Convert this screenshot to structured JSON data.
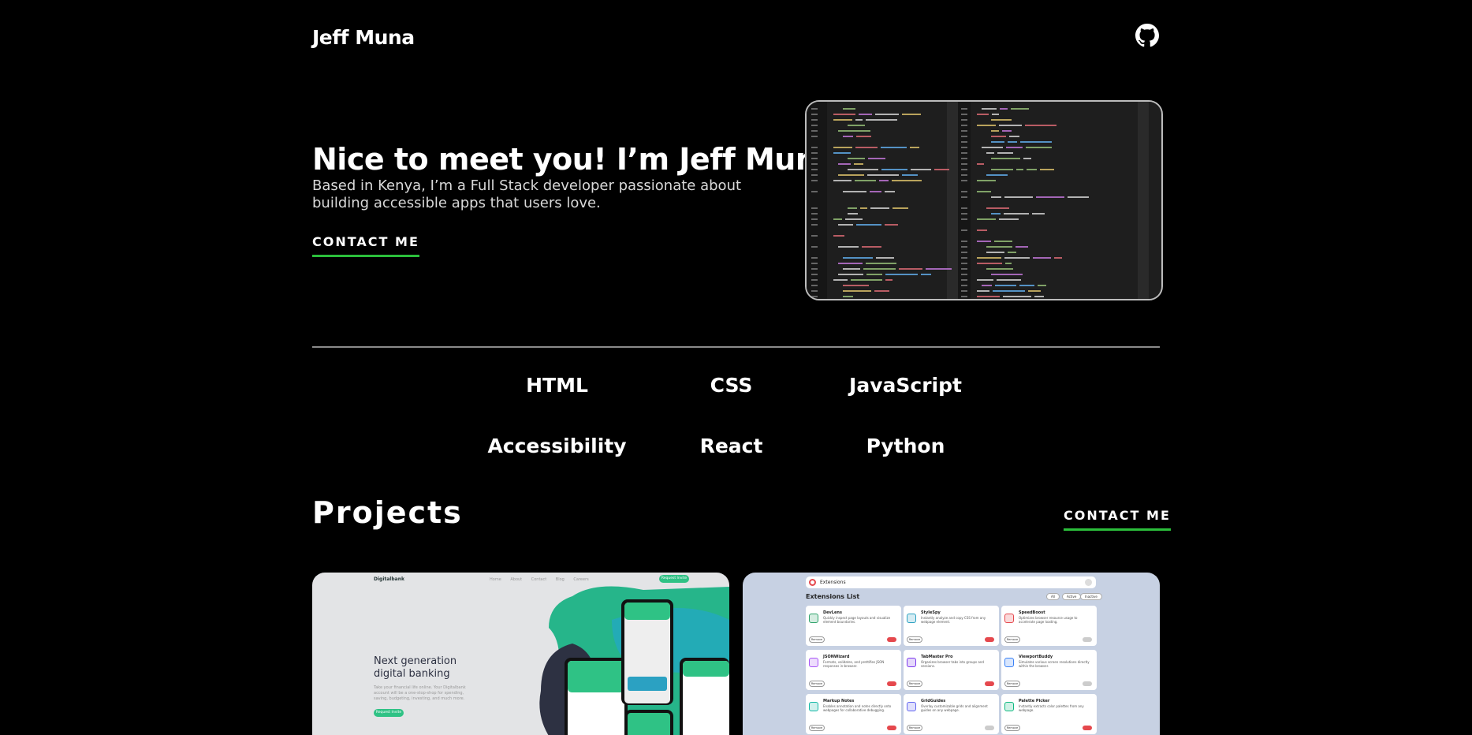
{
  "header": {
    "brand": "Jeff Muna",
    "github_icon": "github-icon"
  },
  "hero": {
    "title": "Nice to meet you! I’m Jeff Muna.",
    "text": "Based in Kenya, I’m a Full Stack developer passionate about building accessible apps that users love.",
    "cta": "CONTACT ME"
  },
  "skills": [
    "HTML",
    "CSS",
    "JavaScript",
    "Accessibility",
    "React",
    "Python"
  ],
  "projects": {
    "title": "Projects",
    "cta": "CONTACT ME",
    "card1": {
      "brand": "Digitalbank",
      "links": "Home About Contact Blog Careers",
      "button": "Request Invite",
      "heading": "Next generation digital banking",
      "text": "Take your financial life online. Your Digitalbank account will be a one-stop-shop for spending, saving, budgeting, investing, and much more.",
      "button2": "Request Invite"
    },
    "card2": {
      "brand": "Extensions",
      "title": "Extensions List",
      "filters": [
        "All",
        "Active",
        "Inactive"
      ],
      "remove_label": "Remove",
      "items": [
        {
          "name": "DevLens",
          "desc": "Quickly inspect page layouts and visualize element boundaries."
        },
        {
          "name": "StyleSpy",
          "desc": "Instantly analyze and copy CSS from any webpage element."
        },
        {
          "name": "SpeedBoost",
          "desc": "Optimizes browser resource usage to accelerate page loading."
        },
        {
          "name": "JSONWizard",
          "desc": "Formats, validates, and prettifies JSON responses in-browser."
        },
        {
          "name": "TabMaster Pro",
          "desc": "Organizes browser tabs into groups and sessions."
        },
        {
          "name": "ViewportBuddy",
          "desc": "Simulates various screen resolutions directly within the browser."
        },
        {
          "name": "Markup Notes",
          "desc": "Enables annotation and notes directly onto webpages for collaborative debugging."
        },
        {
          "name": "GridGuides",
          "desc": "Overlay customizable grids and alignment guides on any webpage."
        },
        {
          "name": "Palette Picker",
          "desc": "Instantly extracts color palettes from any webpage."
        }
      ]
    }
  },
  "colors": {
    "accent": "#2bbf3b",
    "background": "#000000",
    "text": "#ffffff"
  }
}
